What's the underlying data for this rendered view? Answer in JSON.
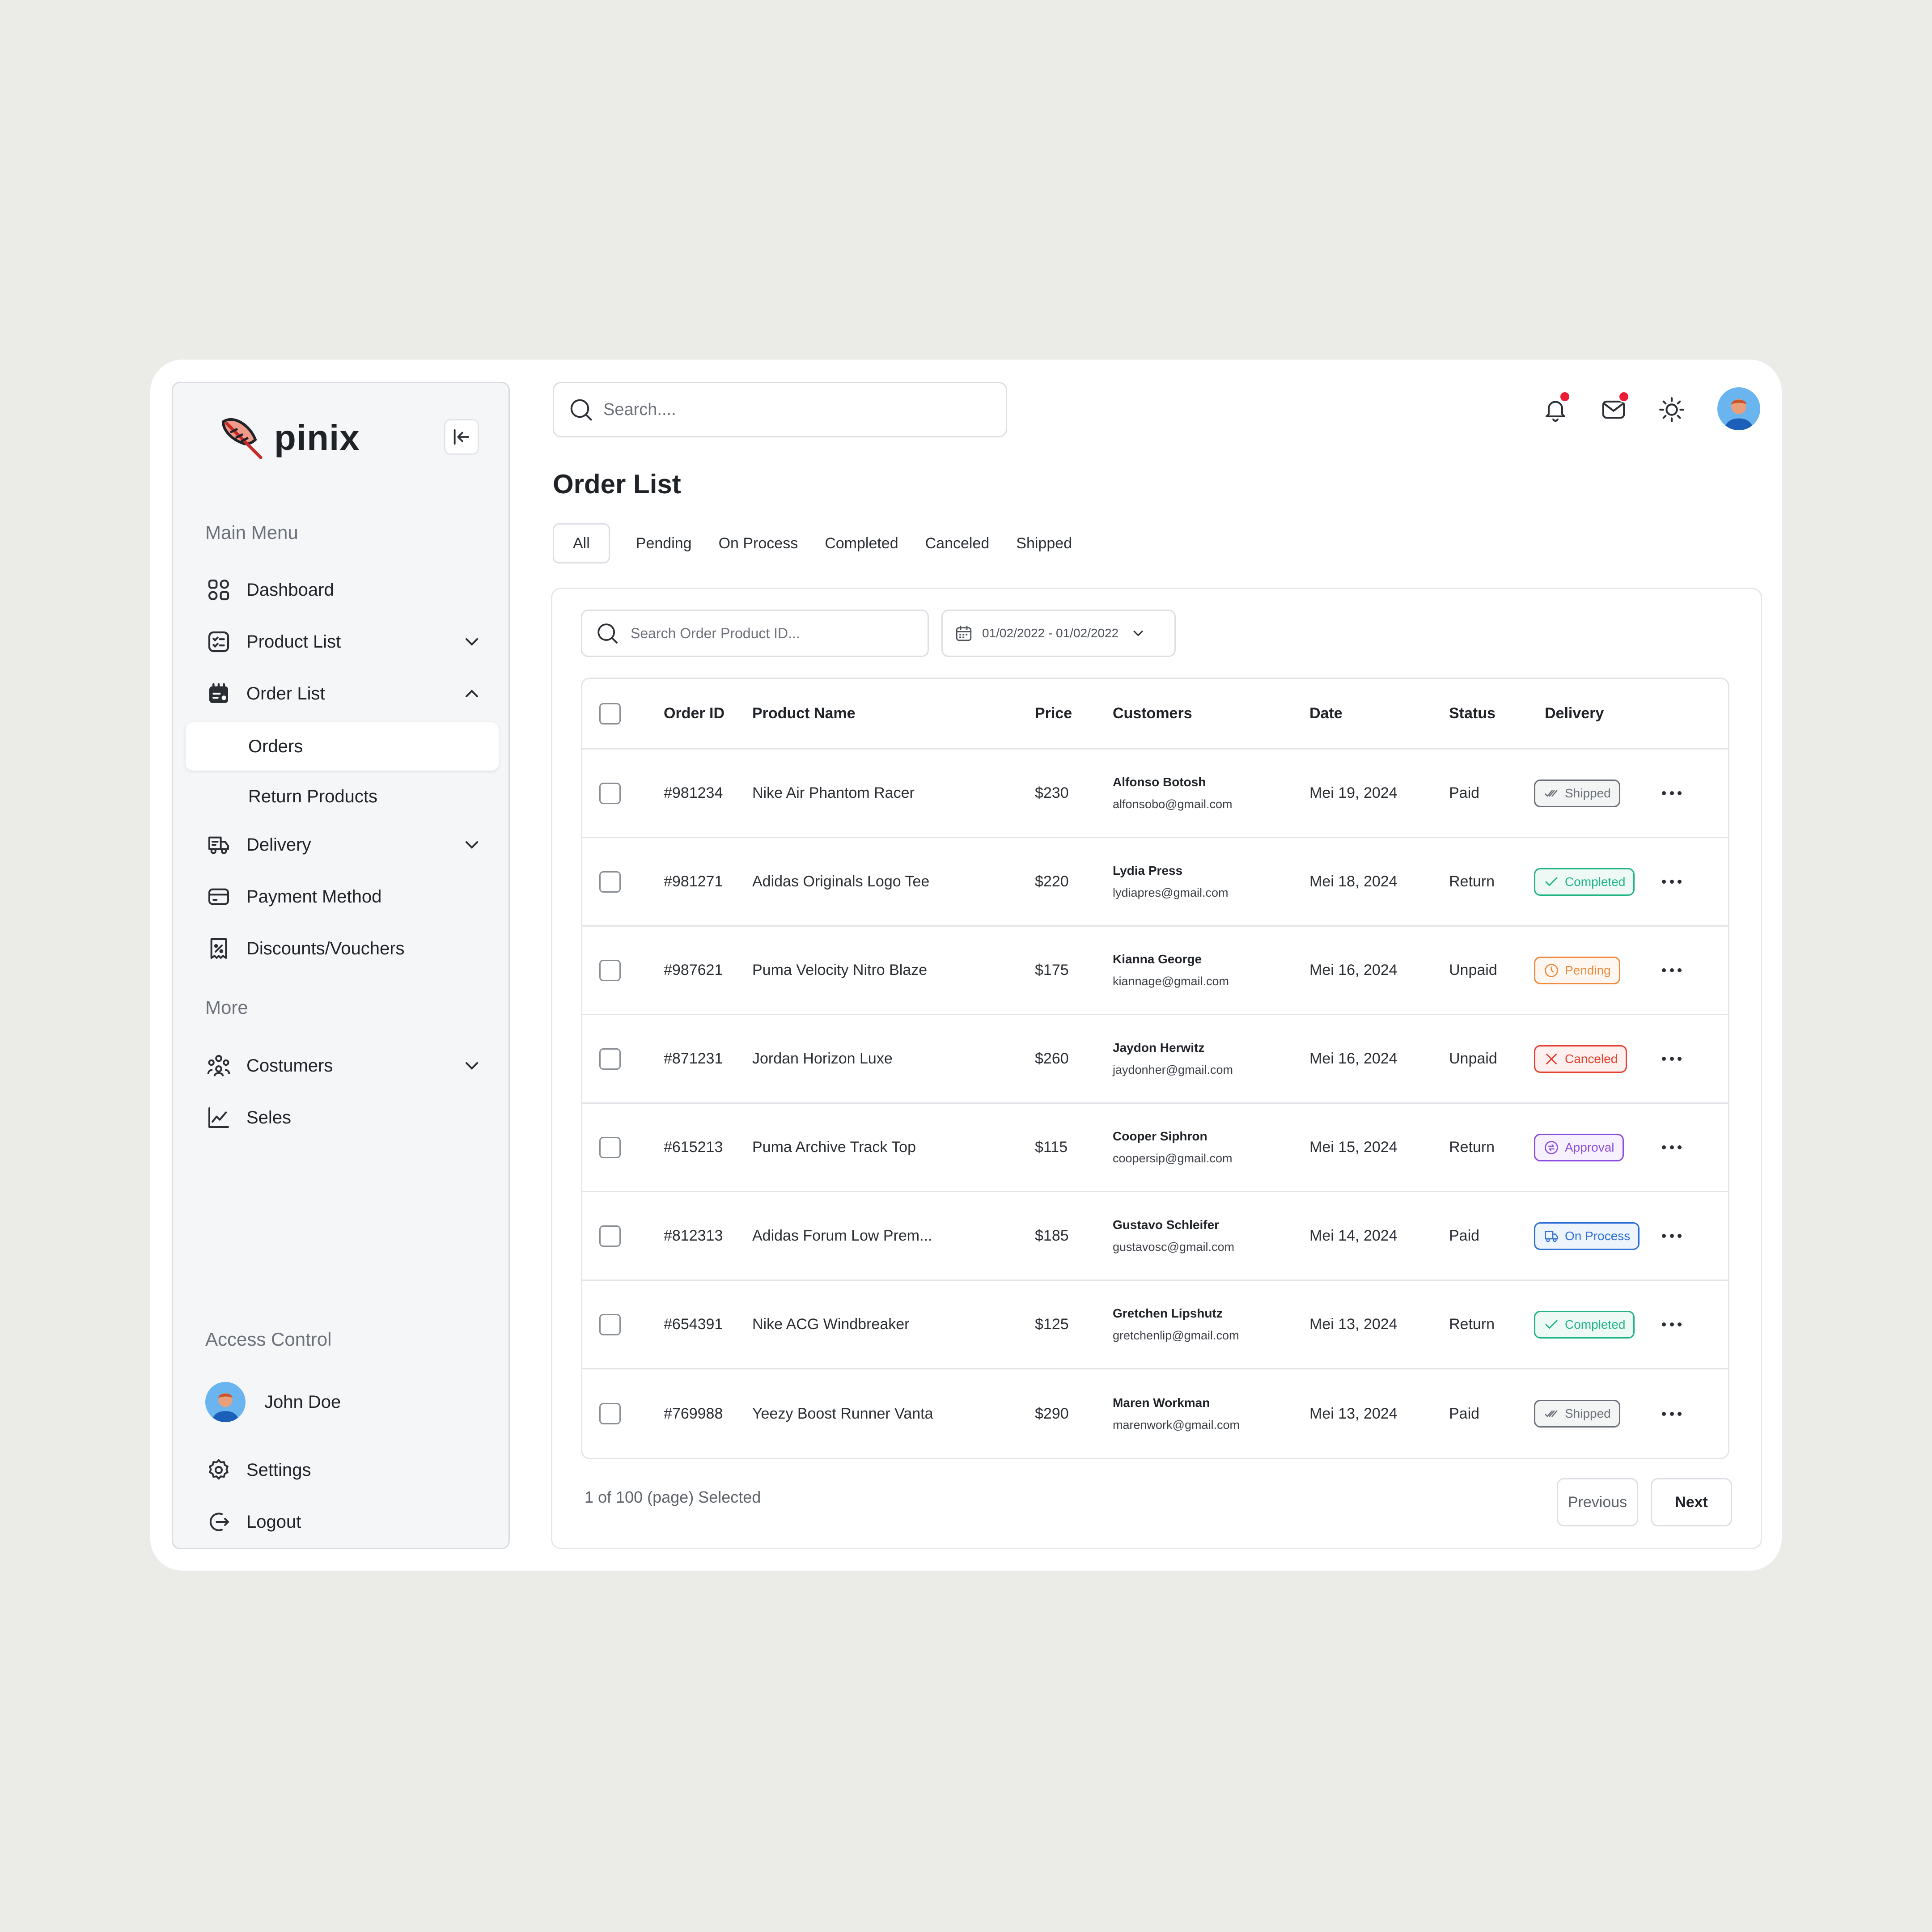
{
  "app": {
    "name": "pinix"
  },
  "sidebar": {
    "main_menu_title": "Main Menu",
    "items": [
      {
        "label": "Dashboard",
        "icon": "grid-icon"
      },
      {
        "label": "Product List",
        "icon": "checklist-icon"
      },
      {
        "label": "Order List",
        "icon": "calendar-order-icon"
      },
      {
        "label": "Delivery",
        "icon": "truck-icon"
      },
      {
        "label": "Payment Method",
        "icon": "card-icon"
      },
      {
        "label": "Discounts/Vouchers",
        "icon": "voucher-icon"
      }
    ],
    "order_sub": [
      "Orders",
      "Return Products"
    ],
    "more_title": "More",
    "more_items": [
      {
        "label": "Costumers",
        "icon": "users-icon"
      },
      {
        "label": "Seles",
        "icon": "chart-icon"
      }
    ],
    "access_title": "Access Control",
    "user_name": "John Doe",
    "settings_label": "Settings",
    "logout_label": "Logout"
  },
  "topbar": {
    "search_placeholder": "Search...."
  },
  "page": {
    "title": "Order List",
    "tabs": [
      "All",
      "Pending",
      "On Process",
      "Completed",
      "Canceled",
      "Shipped"
    ],
    "active_tab": "All"
  },
  "filters": {
    "search_placeholder": "Search Order Product ID...",
    "date_range": "01/02/2022 - 01/02/2022"
  },
  "table": {
    "headers": [
      "Order ID",
      "Product Name",
      "Price",
      "Customers",
      "Date",
      "Status",
      "Delivery"
    ],
    "rows": [
      {
        "id": "#981234",
        "product": "Nike Air Phantom Racer",
        "price": "$230",
        "customer": "Alfonso Botosh",
        "email": "alfonsobo@gmail.com",
        "date": "Mei 19, 2024",
        "status": "Paid",
        "delivery": "Shipped"
      },
      {
        "id": "#981271",
        "product": "Adidas Originals Logo Tee",
        "price": "$220",
        "customer": "Lydia Press",
        "email": "lydiapres@gmail.com",
        "date": "Mei 18, 2024",
        "status": "Return",
        "delivery": "Completed"
      },
      {
        "id": "#987621",
        "product": "Puma Velocity Nitro Blaze",
        "price": "$175",
        "customer": "Kianna George",
        "email": "kiannage@gmail.com",
        "date": "Mei 16, 2024",
        "status": "Unpaid",
        "delivery": "Pending"
      },
      {
        "id": "#871231",
        "product": "Jordan Horizon Luxe",
        "price": "$260",
        "customer": "Jaydon Herwitz",
        "email": "jaydonher@gmail.com",
        "date": "Mei 16, 2024",
        "status": "Unpaid",
        "delivery": "Canceled"
      },
      {
        "id": "#615213",
        "product": "Puma Archive Track Top",
        "price": "$115",
        "customer": "Cooper Siphron",
        "email": "coopersip@gmail.com",
        "date": "Mei 15, 2024",
        "status": "Return",
        "delivery": "Approval"
      },
      {
        "id": "#812313",
        "product": "Adidas Forum Low Prem...",
        "price": "$185",
        "customer": "Gustavo Schleifer",
        "email": "gustavosc@gmail.com",
        "date": "Mei 14, 2024",
        "status": "Paid",
        "delivery": "On Process"
      },
      {
        "id": "#654391",
        "product": "Nike ACG Windbreaker",
        "price": "$125",
        "customer": "Gretchen Lipshutz",
        "email": "gretchenlip@gmail.com",
        "date": "Mei 13, 2024",
        "status": "Return",
        "delivery": "Completed"
      },
      {
        "id": "#769988",
        "product": "Yeezy Boost Runner Vanta",
        "price": "$290",
        "customer": "Maren Workman",
        "email": "marenwork@gmail.com",
        "date": "Mei 13, 2024",
        "status": "Paid",
        "delivery": "Shipped"
      }
    ]
  },
  "badge_colors": {
    "Shipped": "#6b7079",
    "Completed": "#20b486",
    "Pending": "#f08a3c",
    "Canceled": "#e5402f",
    "Approval": "#8b4fe0",
    "On Process": "#2c6fd6"
  },
  "pagination": {
    "summary": "1 of 100 (page) Selected",
    "previous": "Previous",
    "next": "Next"
  },
  "colors": {
    "notification_dot": "#ea1d35",
    "background": "#ebebe7"
  }
}
